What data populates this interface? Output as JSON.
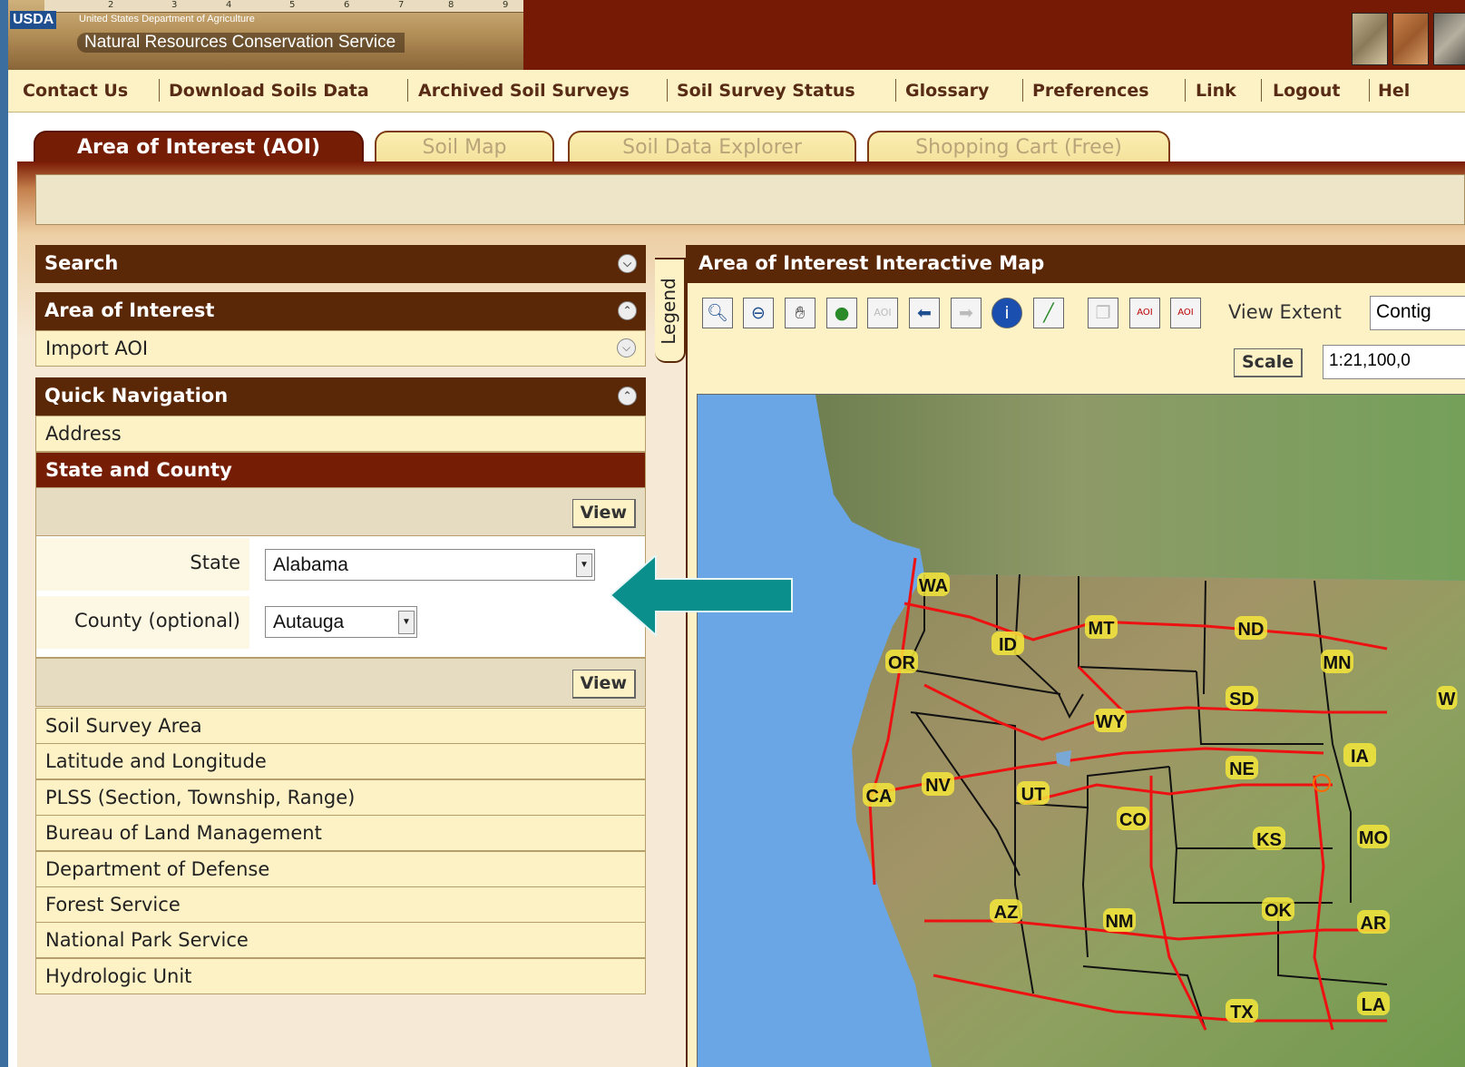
{
  "banner": {
    "usda": "USDA",
    "department": "United States Department of Agriculture",
    "agency": "Natural Resources Conservation Service",
    "ruler_marks": [
      "2",
      "3",
      "4",
      "5",
      "6",
      "7",
      "8",
      "9"
    ]
  },
  "nav": {
    "items": [
      "Contact Us",
      "Download Soils Data",
      "Archived Soil Surveys",
      "Soil Survey Status",
      "Glossary",
      "Preferences",
      "Link",
      "Logout",
      "Hel"
    ]
  },
  "tabs": [
    {
      "label": "Area of Interest (AOI)",
      "active": true
    },
    {
      "label": "Soil Map",
      "active": false
    },
    {
      "label": "Soil Data Explorer",
      "active": false
    },
    {
      "label": "Shopping Cart (Free)",
      "active": false
    }
  ],
  "left_panel": {
    "search_header": "Search",
    "aoi_header": "Area of Interest",
    "import_aoi": "Import AOI",
    "quick_nav_header": "Quick Navigation",
    "address": "Address",
    "state_county": "State and County",
    "view_label": "View",
    "state_label": "State",
    "state_value": "Alabama",
    "county_label": "County (optional)",
    "county_value": "Autauga",
    "nav_items": [
      "Soil Survey Area",
      "Latitude and Longitude",
      "PLSS (Section, Township, Range)",
      "Bureau of Land Management",
      "Department of Defense",
      "Forest Service",
      "National Park Service",
      "Hydrologic Unit"
    ]
  },
  "legend_tab": "Legend",
  "map": {
    "title": "Area of Interest Interactive Map",
    "view_extent_label": "View Extent",
    "view_extent_value": "Contig",
    "scale_button": "Scale",
    "scale_value": "1:21,100,0",
    "tools": [
      "zoom-in-icon",
      "zoom-out-icon",
      "pan-hand-icon",
      "globe-icon",
      "aoi-disabled-icon",
      "back-arrow-icon",
      "forward-arrow-icon",
      "info-icon",
      "measure-icon",
      "copy-icon",
      "aoi-rectangle-icon",
      "aoi-polygon-icon"
    ],
    "state_labels": [
      "WA",
      "OR",
      "ID",
      "MT",
      "ND",
      "MN",
      "SD",
      "WY",
      "NE",
      "IA",
      "CA",
      "NV",
      "UT",
      "CO",
      "KS",
      "MO",
      "AZ",
      "NM",
      "OK",
      "AR",
      "TX",
      "LA",
      "W"
    ]
  },
  "colors": {
    "banner_bg": "#771a05",
    "nav_bg": "#fdf2c6",
    "panel_header": "#5a2707",
    "selected_row": "#761d06",
    "annotation_arrow": "#0a8f8c",
    "map_water": "#6aa6e6",
    "highway": "#ee1111"
  }
}
